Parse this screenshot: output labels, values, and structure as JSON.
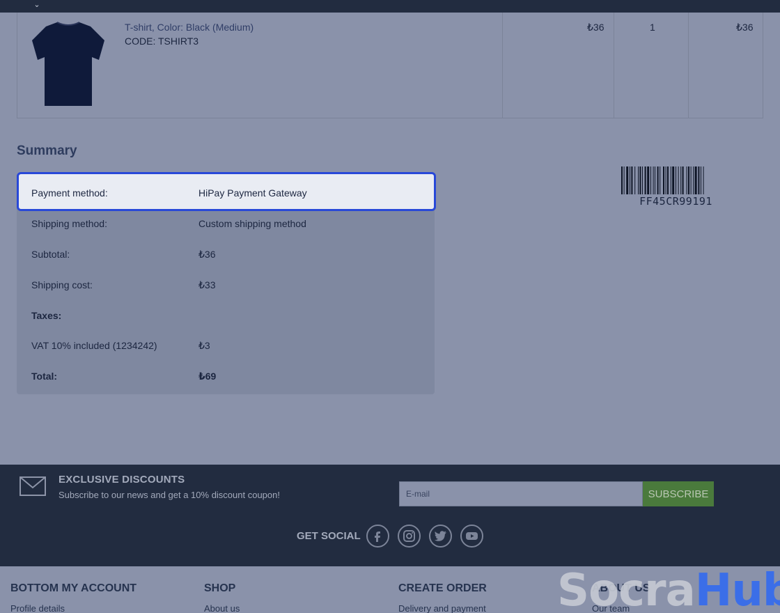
{
  "product": {
    "name": "T-shirt, Color: Black (Medium)",
    "code": "CODE: TSHIRT3",
    "unit_price": "₺36",
    "quantity": "1",
    "total": "₺36"
  },
  "summary": {
    "title": "Summary",
    "payment_label": "Payment method:",
    "payment_value": "HiPay Payment Gateway",
    "rows": [
      {
        "label": "Shipping method:",
        "value": "Custom shipping method"
      },
      {
        "label": "Subtotal:",
        "value": "₺36"
      },
      {
        "label": "Shipping cost:",
        "value": "₺33"
      },
      {
        "label": "Taxes:",
        "value": ""
      },
      {
        "label": "VAT 10% included (1234242)",
        "value": "₺3"
      },
      {
        "label": "Total:",
        "value": "₺69"
      }
    ]
  },
  "barcode": {
    "text": "FF45CR99191"
  },
  "newsletter": {
    "title": "EXCLUSIVE DISCOUNTS",
    "subtitle": "Subscribe to our news and get a 10% discount coupon!",
    "email_placeholder": "E-mail",
    "subscribe_label": "SUBSCRIBE"
  },
  "social": {
    "label": "GET SOCIAL",
    "icons": [
      "facebook-icon",
      "instagram-icon",
      "twitter-icon",
      "youtube-icon"
    ]
  },
  "footer": {
    "columns": [
      {
        "heading": "BOTTOM MY ACCOUNT",
        "link": "Profile details"
      },
      {
        "heading": "SHOP",
        "link": "About us"
      },
      {
        "heading": "CREATE ORDER",
        "link": "Delivery and payment"
      },
      {
        "heading": "ABOUT US",
        "link": "Our team"
      }
    ]
  },
  "watermark": {
    "part1": "Socra",
    "part2": "Hub"
  },
  "colors": {
    "accent_blue": "#2848d8",
    "subscribe_green": "#4a7a3c",
    "footer_dark": "#222c40"
  }
}
